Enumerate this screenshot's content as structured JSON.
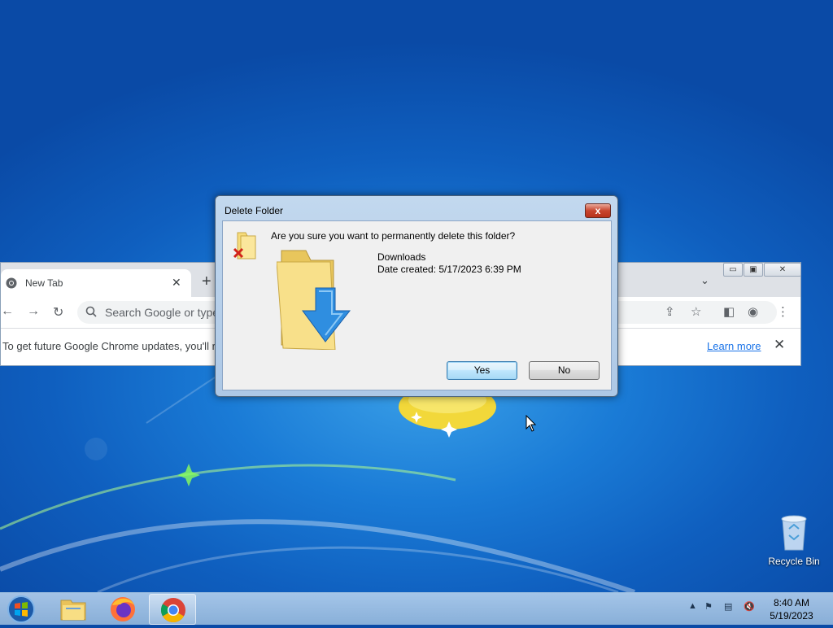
{
  "desktop": {
    "icons": [
      {
        "label": "Recycle Bin",
        "icon": "recycle-bin-icon"
      }
    ]
  },
  "chrome": {
    "tab": {
      "title": "New Tab",
      "icon": "chrome-icon"
    },
    "omnibox": {
      "placeholder": "Search Google or type"
    },
    "infobar": {
      "message": "To get future Google Chrome updates, you'll r",
      "learn_more": "Learn more"
    }
  },
  "dialog": {
    "title": "Delete Folder",
    "question": "Are you sure you want to permanently delete this folder?",
    "folder_name": "Downloads",
    "date_created": "Date created: 5/17/2023 6:39 PM",
    "yes_label": "Yes",
    "no_label": "No",
    "close_label": "x"
  },
  "taskbar": {
    "apps": [
      {
        "name": "Windows Explorer",
        "icon": "folder-icon"
      },
      {
        "name": "Firefox",
        "icon": "firefox-icon"
      },
      {
        "name": "Google Chrome",
        "icon": "chrome-icon",
        "active": true
      }
    ],
    "clock": {
      "time": "8:40 AM",
      "date": "5/19/2023"
    }
  },
  "colors": {
    "desktop": "#1a7bd6",
    "dialog_frame": "#adc8e6",
    "close_button": "#c8452e",
    "link": "#1a73e8"
  }
}
